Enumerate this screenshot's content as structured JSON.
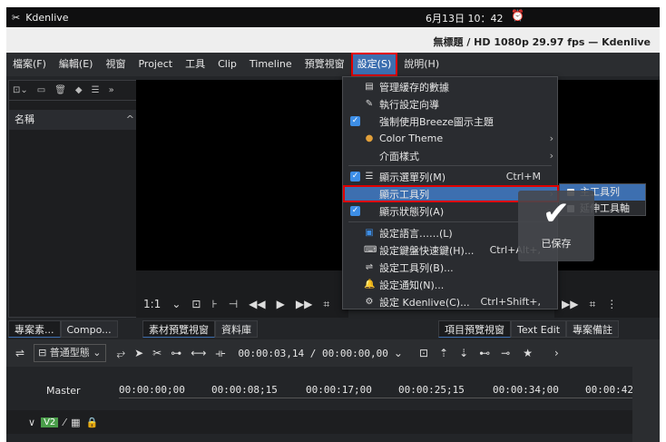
{
  "system": {
    "app_name": "Kdenlive",
    "clock": "6月13日 10：42",
    "alarm_icon": "alarm-icon"
  },
  "window": {
    "title": "無標題 / HD 1080p 29.97 fps — Kdenlive"
  },
  "menubar": {
    "items": [
      "檔案(F)",
      "編輯(E)",
      "視窗",
      "Project",
      "工具",
      "Clip",
      "Timeline",
      "預覽視窗",
      "設定(S)",
      "說明(H)"
    ],
    "active_index": 8
  },
  "settings_menu": {
    "items": [
      {
        "label": "管理緩存的數據",
        "icon": "cache-icon",
        "shortcut": "",
        "checked": false,
        "submenu": false
      },
      {
        "label": "執行設定向導",
        "icon": "wizard-icon",
        "shortcut": "",
        "checked": false,
        "submenu": false
      },
      {
        "label": "強制使用Breeze圖示主題",
        "icon": "",
        "shortcut": "",
        "checked": true,
        "submenu": false
      },
      {
        "label": "Color Theme",
        "icon": "color-theme-icon",
        "shortcut": "",
        "checked": false,
        "submenu": true
      },
      {
        "label": "介面樣式",
        "icon": "",
        "shortcut": "",
        "checked": false,
        "submenu": true
      },
      {
        "label": "顯示選單列(M)",
        "icon": "menubar-icon",
        "shortcut": "Ctrl+M",
        "checked": true,
        "submenu": false
      },
      {
        "label": "顯示工具列",
        "icon": "",
        "shortcut": "",
        "checked": false,
        "submenu": true,
        "highlighted": true
      },
      {
        "label": "顯示狀態列(A)",
        "icon": "",
        "shortcut": "",
        "checked": true,
        "submenu": false
      },
      {
        "label": "設定語言……(L)",
        "icon": "language-icon",
        "shortcut": "",
        "checked": false,
        "submenu": false
      },
      {
        "label": "設定鍵盤快速鍵(H)...",
        "icon": "keyboard-icon",
        "shortcut": "Ctrl+Alt+,",
        "checked": false,
        "submenu": false
      },
      {
        "label": "設定工具列(B)...",
        "icon": "toolbar-config-icon",
        "shortcut": "",
        "checked": false,
        "submenu": false
      },
      {
        "label": "設定通知(N)...",
        "icon": "bell-icon",
        "shortcut": "",
        "checked": false,
        "submenu": false
      },
      {
        "label": "設定 Kdenlive(C)...",
        "icon": "gear-icon",
        "shortcut": "Ctrl+Shift+,",
        "checked": false,
        "submenu": false
      }
    ]
  },
  "toolbar_submenu": {
    "items": [
      "主工具列",
      "延伸工具軸"
    ]
  },
  "toast": {
    "message": "已保存"
  },
  "bin": {
    "column_header": "名稱"
  },
  "monitor_left": {
    "zoom": "1:1"
  },
  "tabs_left": [
    "專案素...",
    "Compo..."
  ],
  "tabs_middle": [
    "素材預覽視窗",
    "資料庫"
  ],
  "tabs_right": [
    "項目預覽視窗",
    "Text Edit",
    "專案備註"
  ],
  "timeline": {
    "mode": "普通型態",
    "timecode": "00:00:03,14 / 00:00:00,00",
    "master_label": "Master",
    "ruler": [
      "00:00:00;00",
      "00:00:08;15",
      "00:00:17;00",
      "00:00:25;15",
      "00:00:34;00",
      "00:00:42"
    ],
    "track_label": "V2"
  }
}
